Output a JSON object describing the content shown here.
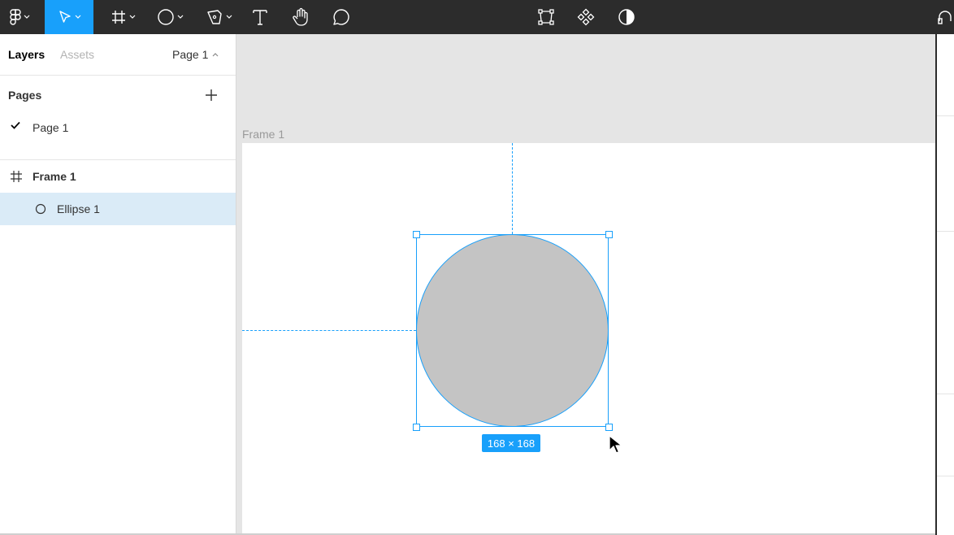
{
  "toolbar": {
    "tools": [
      {
        "name": "main-menu",
        "icon": "figma-logo-icon",
        "has_caret": true
      },
      {
        "name": "move",
        "icon": "move-arrow-icon",
        "has_caret": true,
        "active": true
      },
      {
        "name": "frame",
        "icon": "frame-hash-icon",
        "has_caret": true
      },
      {
        "name": "shape",
        "icon": "ellipse-icon",
        "has_caret": true
      },
      {
        "name": "pen",
        "icon": "pen-icon",
        "has_caret": true
      },
      {
        "name": "text",
        "icon": "text-icon"
      },
      {
        "name": "hand",
        "icon": "hand-icon"
      },
      {
        "name": "comment",
        "icon": "comment-icon"
      },
      {
        "name": "edit-object",
        "icon": "edit-object-icon"
      },
      {
        "name": "components",
        "icon": "component-icon"
      },
      {
        "name": "mask",
        "icon": "mask-icon"
      }
    ],
    "accent_color": "#18a0fb",
    "background_color": "#2c2c2c"
  },
  "left_panel": {
    "tabs": {
      "layers": "Layers",
      "assets": "Assets"
    },
    "page_selector": "Page 1",
    "pages_title": "Pages",
    "pages": [
      {
        "label": "Page 1",
        "selected": true
      }
    ],
    "layers": [
      {
        "label": "Frame 1",
        "icon": "frame-hash-icon"
      },
      {
        "label": "Ellipse 1",
        "icon": "ellipse-icon",
        "selected": true
      }
    ]
  },
  "canvas": {
    "frame_label": "Frame 1",
    "selection_size": "168 × 168",
    "ellipse_fill": "#c4c4c4",
    "selection_color": "#18a0fb"
  }
}
